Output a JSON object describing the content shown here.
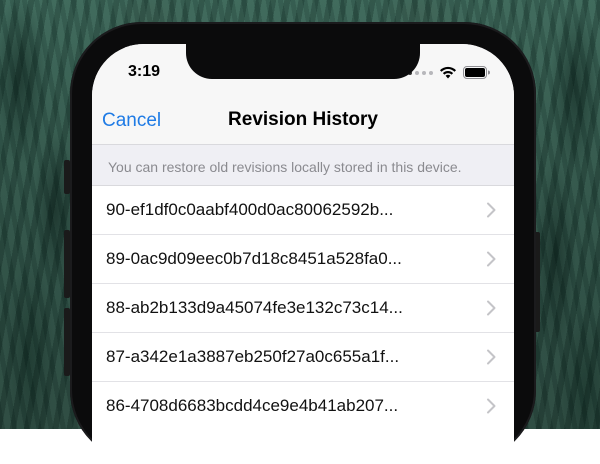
{
  "status_bar": {
    "time": "3:19",
    "icons": [
      "signal-dots-icon",
      "wifi-icon",
      "battery-icon"
    ]
  },
  "nav": {
    "cancel_label": "Cancel",
    "title": "Revision History"
  },
  "section": {
    "header": "You can restore old revisions locally stored in this device."
  },
  "revisions": [
    {
      "label": "90-ef1df0c0aabf400d0ac80062592b..."
    },
    {
      "label": "89-0ac9d09eec0b7d18c8451a528fa0..."
    },
    {
      "label": "88-ab2b133d9a45074fe3e132c73c14..."
    },
    {
      "label": "87-a342e1a3887eb250f27a0c655a1f..."
    },
    {
      "label": "86-4708d6683bcdd4ce9e4b41ab207..."
    }
  ],
  "colors": {
    "accent": "#1f7be5",
    "nav_bg": "#f7f7f7",
    "section_bg": "#efeff4",
    "chevron": "#c4c4c8"
  }
}
